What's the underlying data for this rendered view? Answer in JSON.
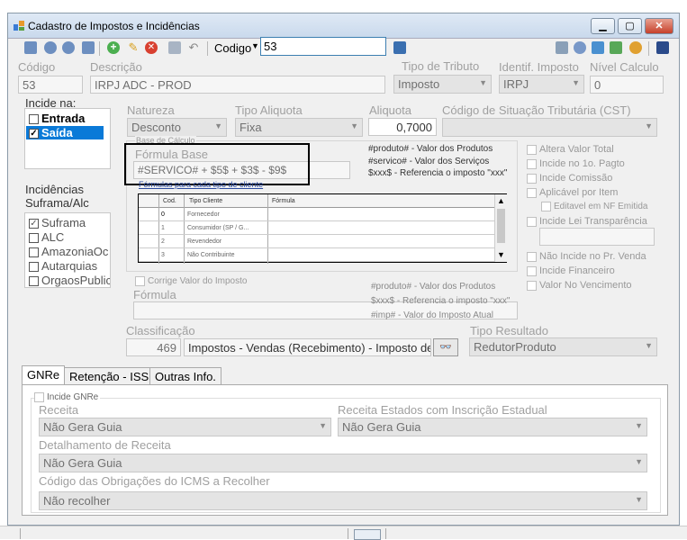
{
  "window": {
    "title": "Cadastro de Impostos e Incidências"
  },
  "toolbar": {
    "codigo_label": "Codigo",
    "codigo_value": "53"
  },
  "header_labels": {
    "codigo": "Código",
    "descricao": "Descrição",
    "tipo_tributo": "Tipo de Tributo",
    "identif_imposto": "Identif. Imposto",
    "nivel_calculo": "Nível Calculo"
  },
  "header_values": {
    "codigo": "53",
    "descricao": "IRPJ ADC - PROD",
    "tipo_tributo": "Imposto",
    "identif_imposto": "IRPJ",
    "nivel_calculo": "0"
  },
  "incide_na": {
    "title": "Incide na:",
    "items": [
      {
        "label": "Entrada",
        "checked": false
      },
      {
        "label": "Saída",
        "checked": true
      }
    ]
  },
  "incidencias": {
    "title_line1": "Incidências",
    "title_line2": "Suframa/Alc",
    "items": [
      {
        "label": "Suframa",
        "checked": true
      },
      {
        "label": "ALC",
        "checked": false
      },
      {
        "label": "AmazoniaOc",
        "checked": false
      },
      {
        "label": "Autarquias",
        "checked": false
      },
      {
        "label": "OrgaosPublic",
        "checked": false
      }
    ]
  },
  "calc": {
    "natureza_label": "Natureza",
    "natureza_value": "Desconto",
    "tipo_aliquota_label": "Tipo Aliquota",
    "tipo_aliquota_value": "Fixa",
    "aliquota_label": "Aliquota",
    "aliquota_value": "0,7000",
    "cst_label": "Código de Situação Tributária (CST)",
    "base_calculo_label": "Base de Cálculo",
    "formula_base_label": "Fórmula Base",
    "formula_base_value": "#SERVICO# + $5$ + $3$ - $9$",
    "formulas_cliente_label": "Fórmulas para cada tipo de cliente"
  },
  "hints1": [
    "#produto# - Valor dos Produtos",
    "#servico# - Valor dos Serviços",
    "$xxx$ - Referencia o imposto \"xxx\""
  ],
  "grid": {
    "headers": [
      "Cod.",
      "Tipo Cliente",
      "Fórmula"
    ],
    "rows": [
      {
        "cod": "0",
        "tipo": "Fornecedor"
      },
      {
        "cod": "1",
        "tipo": "Consumidor (SP / G..."
      },
      {
        "cod": "2",
        "tipo": "Revendedor"
      },
      {
        "cod": "3",
        "tipo": "Não Contribuinte"
      }
    ]
  },
  "options": {
    "items": [
      "Altera Valor Total",
      "Incide no 1o. Pagto",
      "Incide Comissão",
      "Aplicável por Item",
      "Editavel em NF Emitida",
      "Incide Lei Transparência",
      "Não Incide no Pr. Venda",
      "Incide Financeiro",
      "Valor No Vencimento"
    ]
  },
  "corrige": {
    "label": "Corrige Valor do Imposto",
    "formula_label": "Fórmula"
  },
  "hints2": [
    "#produto# - Valor dos Produtos",
    "$xxx$ - Referencia o imposto \"xxx\"",
    "#imp# - Valor do Imposto Atual"
  ],
  "classificacao": {
    "label": "Classificação",
    "code": "469",
    "value": "Impostos - Vendas (Recebimento) - Imposto de R",
    "tipo_resultado_label": "Tipo Resultado",
    "tipo_resultado_value": "RedutorProduto"
  },
  "tabs": [
    "GNRe",
    "Retenção - ISS",
    "Outras Info."
  ],
  "gnre": {
    "incide_label": "Incide GNRe",
    "receita_label": "Receita",
    "receita_value": "Não Gera Guia",
    "receita_estados_label": "Receita Estados com Inscrição Estadual",
    "receita_estados_value": "Não Gera Guia",
    "detalhamento_label": "Detalhamento de Receita",
    "detalhamento_value": "Não Gera Guia",
    "codigo_obrig_label": "Código das Obrigações do ICMS a Recolher",
    "codigo_obrig_value": "Não recolher"
  }
}
